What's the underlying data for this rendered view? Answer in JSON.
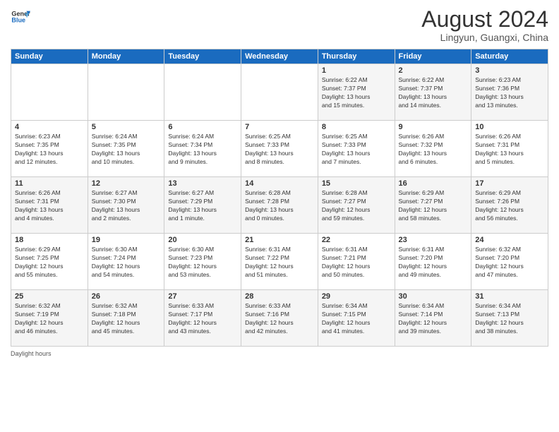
{
  "header": {
    "logo_line1": "General",
    "logo_line2": "Blue",
    "main_title": "August 2024",
    "subtitle": "Lingyun, Guangxi, China"
  },
  "days_of_week": [
    "Sunday",
    "Monday",
    "Tuesday",
    "Wednesday",
    "Thursday",
    "Friday",
    "Saturday"
  ],
  "weeks": [
    [
      {
        "day": "",
        "info": ""
      },
      {
        "day": "",
        "info": ""
      },
      {
        "day": "",
        "info": ""
      },
      {
        "day": "",
        "info": ""
      },
      {
        "day": "1",
        "info": "Sunrise: 6:22 AM\nSunset: 7:37 PM\nDaylight: 13 hours\nand 15 minutes."
      },
      {
        "day": "2",
        "info": "Sunrise: 6:22 AM\nSunset: 7:37 PM\nDaylight: 13 hours\nand 14 minutes."
      },
      {
        "day": "3",
        "info": "Sunrise: 6:23 AM\nSunset: 7:36 PM\nDaylight: 13 hours\nand 13 minutes."
      }
    ],
    [
      {
        "day": "4",
        "info": "Sunrise: 6:23 AM\nSunset: 7:35 PM\nDaylight: 13 hours\nand 12 minutes."
      },
      {
        "day": "5",
        "info": "Sunrise: 6:24 AM\nSunset: 7:35 PM\nDaylight: 13 hours\nand 10 minutes."
      },
      {
        "day": "6",
        "info": "Sunrise: 6:24 AM\nSunset: 7:34 PM\nDaylight: 13 hours\nand 9 minutes."
      },
      {
        "day": "7",
        "info": "Sunrise: 6:25 AM\nSunset: 7:33 PM\nDaylight: 13 hours\nand 8 minutes."
      },
      {
        "day": "8",
        "info": "Sunrise: 6:25 AM\nSunset: 7:33 PM\nDaylight: 13 hours\nand 7 minutes."
      },
      {
        "day": "9",
        "info": "Sunrise: 6:26 AM\nSunset: 7:32 PM\nDaylight: 13 hours\nand 6 minutes."
      },
      {
        "day": "10",
        "info": "Sunrise: 6:26 AM\nSunset: 7:31 PM\nDaylight: 13 hours\nand 5 minutes."
      }
    ],
    [
      {
        "day": "11",
        "info": "Sunrise: 6:26 AM\nSunset: 7:31 PM\nDaylight: 13 hours\nand 4 minutes."
      },
      {
        "day": "12",
        "info": "Sunrise: 6:27 AM\nSunset: 7:30 PM\nDaylight: 13 hours\nand 2 minutes."
      },
      {
        "day": "13",
        "info": "Sunrise: 6:27 AM\nSunset: 7:29 PM\nDaylight: 13 hours\nand 1 minute."
      },
      {
        "day": "14",
        "info": "Sunrise: 6:28 AM\nSunset: 7:28 PM\nDaylight: 13 hours\nand 0 minutes."
      },
      {
        "day": "15",
        "info": "Sunrise: 6:28 AM\nSunset: 7:27 PM\nDaylight: 12 hours\nand 59 minutes."
      },
      {
        "day": "16",
        "info": "Sunrise: 6:29 AM\nSunset: 7:27 PM\nDaylight: 12 hours\nand 58 minutes."
      },
      {
        "day": "17",
        "info": "Sunrise: 6:29 AM\nSunset: 7:26 PM\nDaylight: 12 hours\nand 56 minutes."
      }
    ],
    [
      {
        "day": "18",
        "info": "Sunrise: 6:29 AM\nSunset: 7:25 PM\nDaylight: 12 hours\nand 55 minutes."
      },
      {
        "day": "19",
        "info": "Sunrise: 6:30 AM\nSunset: 7:24 PM\nDaylight: 12 hours\nand 54 minutes."
      },
      {
        "day": "20",
        "info": "Sunrise: 6:30 AM\nSunset: 7:23 PM\nDaylight: 12 hours\nand 53 minutes."
      },
      {
        "day": "21",
        "info": "Sunrise: 6:31 AM\nSunset: 7:22 PM\nDaylight: 12 hours\nand 51 minutes."
      },
      {
        "day": "22",
        "info": "Sunrise: 6:31 AM\nSunset: 7:21 PM\nDaylight: 12 hours\nand 50 minutes."
      },
      {
        "day": "23",
        "info": "Sunrise: 6:31 AM\nSunset: 7:20 PM\nDaylight: 12 hours\nand 49 minutes."
      },
      {
        "day": "24",
        "info": "Sunrise: 6:32 AM\nSunset: 7:20 PM\nDaylight: 12 hours\nand 47 minutes."
      }
    ],
    [
      {
        "day": "25",
        "info": "Sunrise: 6:32 AM\nSunset: 7:19 PM\nDaylight: 12 hours\nand 46 minutes."
      },
      {
        "day": "26",
        "info": "Sunrise: 6:32 AM\nSunset: 7:18 PM\nDaylight: 12 hours\nand 45 minutes."
      },
      {
        "day": "27",
        "info": "Sunrise: 6:33 AM\nSunset: 7:17 PM\nDaylight: 12 hours\nand 43 minutes."
      },
      {
        "day": "28",
        "info": "Sunrise: 6:33 AM\nSunset: 7:16 PM\nDaylight: 12 hours\nand 42 minutes."
      },
      {
        "day": "29",
        "info": "Sunrise: 6:34 AM\nSunset: 7:15 PM\nDaylight: 12 hours\nand 41 minutes."
      },
      {
        "day": "30",
        "info": "Sunrise: 6:34 AM\nSunset: 7:14 PM\nDaylight: 12 hours\nand 39 minutes."
      },
      {
        "day": "31",
        "info": "Sunrise: 6:34 AM\nSunset: 7:13 PM\nDaylight: 12 hours\nand 38 minutes."
      }
    ]
  ],
  "footer": {
    "daylight_label": "Daylight hours"
  }
}
